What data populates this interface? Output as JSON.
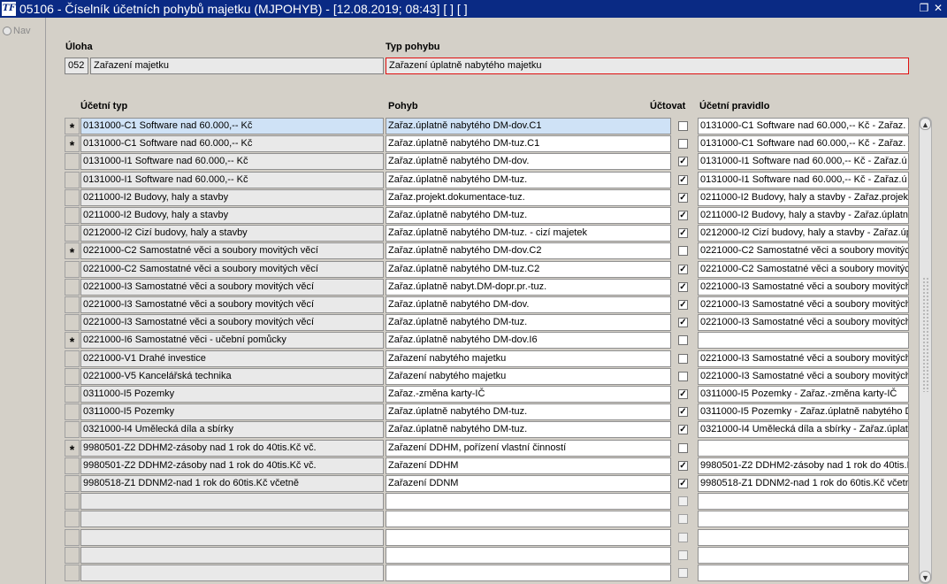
{
  "window": {
    "title": "05106 - Číselník účetních pohybů majetku (MJPOHYB) - [12.08.2019; 08:43]  [ ]  [ ]",
    "icon_text": "TF"
  },
  "nav": {
    "label": "Nav"
  },
  "header": {
    "uloha_label": "Úloha",
    "uloha_code": "052",
    "uloha_name": "Zařazení majetku",
    "typ_label": "Typ pohybu",
    "typ_value": "Zařazení úplatně nabytého majetku"
  },
  "columns": {
    "typ": "Účetní typ",
    "pohyb": "Pohyb",
    "uctovat": "Účtovat",
    "pravidlo": "Účetní pravidlo"
  },
  "rows": [
    {
      "mark": "*",
      "typ": "0131000-C1 Software nad 60.000,-- Kč",
      "pohyb": "Zařaz.úplatně nabytého DM-dov.C1",
      "check": "",
      "pravidlo": "0131000-C1 Software nad 60.000,-- Kč - Zařaz."
    },
    {
      "mark": "*",
      "typ": "0131000-C1 Software nad 60.000,-- Kč",
      "pohyb": "Zařaz.úplatně nabytého DM-tuz.C1",
      "check": "",
      "pravidlo": "0131000-C1 Software nad 60.000,-- Kč - Zařaz."
    },
    {
      "mark": "",
      "typ": "0131000-I1 Software nad 60.000,-- Kč",
      "pohyb": "Zařaz.úplatně nabytého DM-dov.",
      "check": "✓",
      "pravidlo": "0131000-I1 Software nad 60.000,-- Kč - Zařaz.ú"
    },
    {
      "mark": "",
      "typ": "0131000-I1 Software nad 60.000,-- Kč",
      "pohyb": "Zařaz.úplatně nabytého DM-tuz.",
      "check": "✓",
      "pravidlo": "0131000-I1 Software nad 60.000,-- Kč - Zařaz.ú"
    },
    {
      "mark": "",
      "typ": "0211000-I2 Budovy, haly a stavby",
      "pohyb": "Zařaz.projekt.dokumentace-tuz.",
      "check": "✓",
      "pravidlo": "0211000-I2 Budovy, haly a stavby - Zařaz.projek"
    },
    {
      "mark": "",
      "typ": "0211000-I2 Budovy, haly a stavby",
      "pohyb": "Zařaz.úplatně nabytého DM-tuz.",
      "check": "✓",
      "pravidlo": "0211000-I2 Budovy, haly a stavby - Zařaz.úplatn"
    },
    {
      "mark": "",
      "typ": "0212000-I2 Cizí budovy, haly a stavby",
      "pohyb": "Zařaz.úplatně nabytého DM-tuz. - cizí majetek",
      "check": "✓",
      "pravidlo": "0212000-I2 Cizí budovy, haly a stavby - Zařaz.úp"
    },
    {
      "mark": "*",
      "typ": "0221000-C2 Samostatné věci a soubory movitých věcí",
      "pohyb": "Zařaz.úplatně nabytého DM-dov.C2",
      "check": "",
      "pravidlo": "0221000-C2 Samostatné věci a soubory movitýc"
    },
    {
      "mark": "",
      "typ": "0221000-C2 Samostatné věci a soubory movitých věcí",
      "pohyb": "Zařaz.úplatně nabytého DM-tuz.C2",
      "check": "✓",
      "pravidlo": "0221000-C2 Samostatné věci a soubory movitýc"
    },
    {
      "mark": "",
      "typ": "0221000-I3 Samostatné věci a soubory movitých věcí",
      "pohyb": "Zařaz.úplatně nabyt.DM-dopr.pr.-tuz.",
      "check": "✓",
      "pravidlo": "0221000-I3 Samostatné věci a soubory movitých"
    },
    {
      "mark": "",
      "typ": "0221000-I3 Samostatné věci a soubory movitých věcí",
      "pohyb": "Zařaz.úplatně nabytého DM-dov.",
      "check": "✓",
      "pravidlo": "0221000-I3 Samostatné věci a soubory movitých"
    },
    {
      "mark": "",
      "typ": "0221000-I3 Samostatné věci a soubory movitých věcí",
      "pohyb": "Zařaz.úplatně nabytého DM-tuz.",
      "check": "✓",
      "pravidlo": "0221000-I3 Samostatné věci a soubory movitých"
    },
    {
      "mark": "*",
      "typ": "0221000-I6  Samostatné věci - učební pomůcky",
      "pohyb": "Zařaz.úplatně nabytého DM-dov.I6",
      "check": "",
      "pravidlo": ""
    },
    {
      "mark": "",
      "typ": "0221000-V1 Drahé investice",
      "pohyb": "Zařazení nabytého majetku",
      "check": "",
      "pravidlo": "0221000-I3 Samostatné věci a soubory movitých"
    },
    {
      "mark": "",
      "typ": "0221000-V5 Kancelářská technika",
      "pohyb": "Zařazení nabytého majetku",
      "check": "",
      "pravidlo": "0221000-I3 Samostatné věci a soubory movitých"
    },
    {
      "mark": "",
      "typ": "0311000-I5 Pozemky",
      "pohyb": "Zařaz.-změna karty-IČ",
      "check": "✓",
      "pravidlo": "0311000-I5 Pozemky - Zařaz.-změna karty-IČ"
    },
    {
      "mark": "",
      "typ": "0311000-I5 Pozemky",
      "pohyb": "Zařaz.úplatně nabytého DM-tuz.",
      "check": "✓",
      "pravidlo": "0311000-I5 Pozemky - Zařaz.úplatně nabytého D"
    },
    {
      "mark": "",
      "typ": "0321000-I4 Umělecká díla a sbírky",
      "pohyb": "Zařaz.úplatně nabytého DM-tuz.",
      "check": "✓",
      "pravidlo": "0321000-I4 Umělecká díla a sbírky - Zařaz.úplatn"
    },
    {
      "mark": "*",
      "typ": "9980501-Z2 DDHM2-zásoby nad 1 rok do 40tis.Kč vč.",
      "pohyb": "Zařazení DDHM, pořízení vlastní činností",
      "check": "",
      "pravidlo": ""
    },
    {
      "mark": "",
      "typ": "9980501-Z2 DDHM2-zásoby nad 1 rok do 40tis.Kč vč.",
      "pohyb": "Zařazení DDHM",
      "check": "✓",
      "pravidlo": "9980501-Z2 DDHM2-zásoby nad 1 rok do 40tis.K"
    },
    {
      "mark": "",
      "typ": "9980518-Z1 DDNM2-nad 1 rok do 60tis.Kč včetně",
      "pohyb": "Zařazení DDNM",
      "check": "✓",
      "pravidlo": "9980518-Z1 DDNM2-nad 1 rok do 60tis.Kč včetn"
    },
    {
      "mark": "",
      "typ": "",
      "pohyb": "",
      "check": "",
      "pravidlo": ""
    },
    {
      "mark": "",
      "typ": "",
      "pohyb": "",
      "check": "",
      "pravidlo": ""
    },
    {
      "mark": "",
      "typ": "",
      "pohyb": "",
      "check": "",
      "pravidlo": ""
    },
    {
      "mark": "",
      "typ": "",
      "pohyb": "",
      "check": "",
      "pravidlo": ""
    },
    {
      "mark": "",
      "typ": "",
      "pohyb": "",
      "check": "",
      "pravidlo": ""
    }
  ],
  "scrollbar": {
    "up_icon": "▲",
    "down_icon": "▼"
  }
}
